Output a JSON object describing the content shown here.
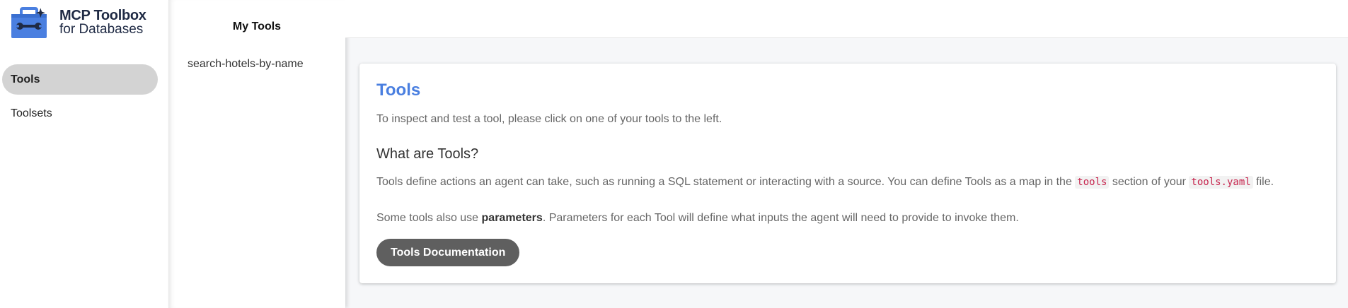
{
  "logo": {
    "title": "MCP Toolbox",
    "subtitle": "for Databases",
    "icon": "toolbox-wrench-icon",
    "colors": {
      "blue": "#4a7fe0",
      "dark": "#1f2a44"
    }
  },
  "sidebar": {
    "items": [
      {
        "label": "Tools",
        "active": true
      },
      {
        "label": "Toolsets",
        "active": false
      }
    ]
  },
  "tools_panel": {
    "title": "My Tools",
    "tools": [
      "search-hotels-by-name"
    ]
  },
  "main": {
    "title": "Tools",
    "intro": "To inspect and test a tool, please click on one of your tools to the left.",
    "heading": "What are Tools?",
    "p1": {
      "before": "Tools define actions an agent can take, such as running a SQL statement or interacting with a source. You can define Tools as a map in the ",
      "code1": "tools",
      "middle": " section of your ",
      "code2": "tools.yaml",
      "after": " file."
    },
    "p2": {
      "before": "Some tools also use ",
      "bold": "parameters",
      "after": ". Parameters for each Tool will define what inputs the agent will need to provide to invoke them."
    },
    "button_label": "Tools Documentation"
  },
  "colors": {
    "accent": "#4a7fe0",
    "button_bg": "#5f5f5f",
    "active_nav_bg": "#d3d3d3",
    "page_bg": "#f6f7f9",
    "code_text": "#c7254e"
  }
}
